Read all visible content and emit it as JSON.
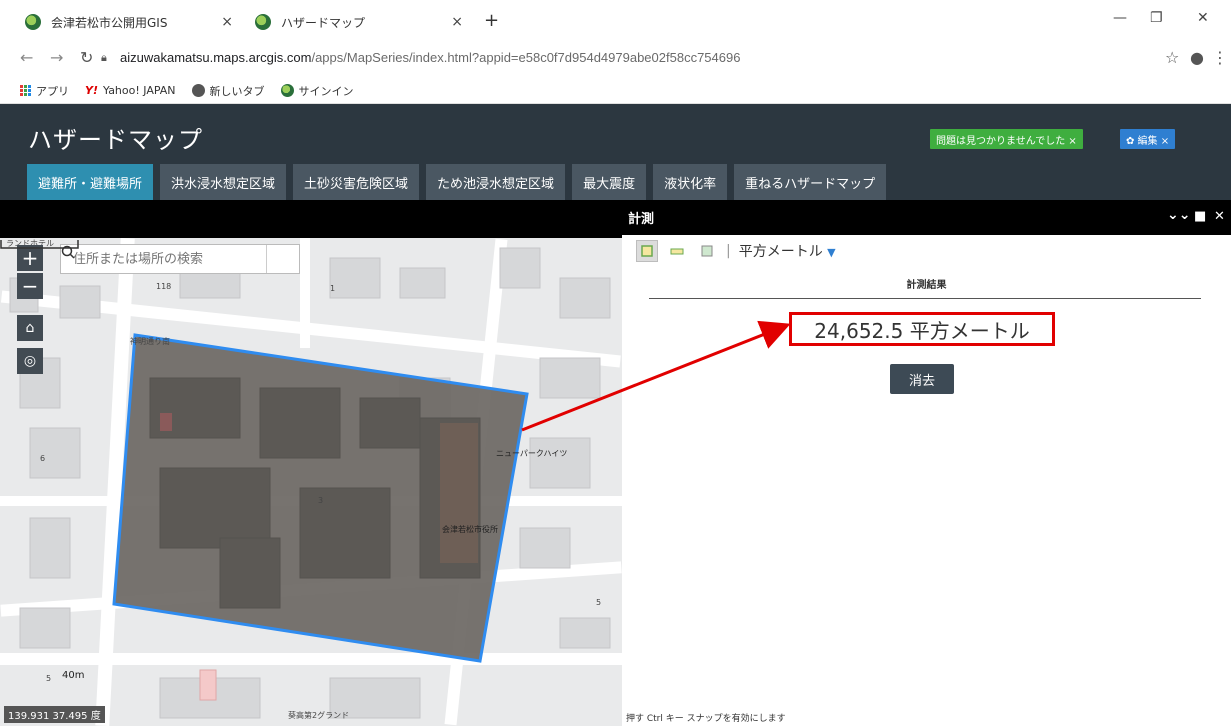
{
  "browser": {
    "tabs": [
      {
        "title": "会津若松市公開用GIS",
        "close": "×"
      },
      {
        "title": "ハザードマップ",
        "close": "×"
      }
    ],
    "new_tab": "+",
    "window_controls": {
      "minimize": "—",
      "restore": "❐",
      "close": "✕"
    },
    "url_host": "aizuwakamatsu.maps.arcgis.com",
    "url_path": "/apps/MapSeries/index.html?appid=e58c0f7d954d4979abe02f58cc754696",
    "bookmarks": [
      "アプリ",
      "Yahoo! JAPAN",
      "新しいタブ",
      "サインイン"
    ],
    "yahoo_mark": "Y!"
  },
  "app": {
    "title": "ハザードマップ",
    "status_badge": "問題は見つかりませんでした ×",
    "edit_badge": "✿ 編集 ×",
    "tabs": [
      "避難所・避難場所",
      "洪水浸水想定区域",
      "土砂災害危険区域",
      "ため池浸水想定区域",
      "最大震度",
      "液状化率",
      "重ねるハザードマップ"
    ]
  },
  "map": {
    "search_placeholder": "住所または場所の検索",
    "zoom_in": "+",
    "zoom_out": "−",
    "labels": {
      "hotel": "ランドホテル",
      "route": "118",
      "street": "神明通り南",
      "newpark": "ニューパークハイツ",
      "cityhall": "会津若松市役所",
      "ground": "葵高第2グランド",
      "n1": "1",
      "n3": "3",
      "n5": "5",
      "n5b": "5",
      "n6": "6"
    },
    "scale_label": "40m",
    "coords": "139.931 37.495 度"
  },
  "panel": {
    "title": "計測",
    "unit": "平方メートル",
    "result_title": "計測結果",
    "result_value": "24,652.5 平方メートル",
    "clear_label": "消去",
    "snap_hint": "押す Ctrl キー スナップを有効にします",
    "icons": {
      "collapse": "»",
      "maximize": "■",
      "close": "✕"
    }
  },
  "colors": {
    "header_bg": "#2c3740",
    "active_tab": "#2e8fb0",
    "highlight": "#e10000",
    "polygon_stroke": "#2f8cf0"
  }
}
